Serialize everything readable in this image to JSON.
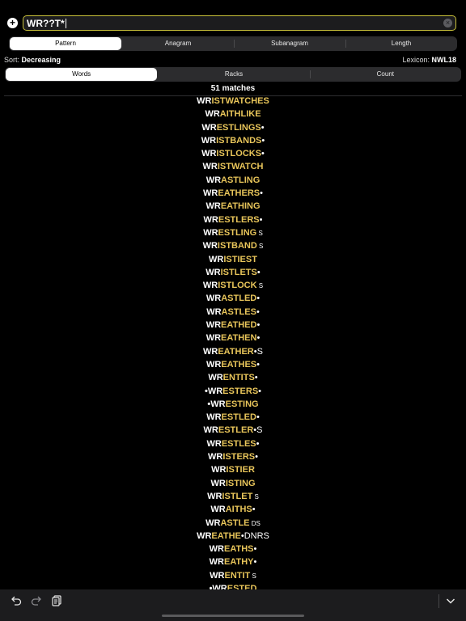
{
  "search": {
    "value": "WR??T*",
    "clear_label": "×"
  },
  "add_label": "+",
  "mode_tabs": [
    {
      "label": "Pattern",
      "active": true
    },
    {
      "label": "Anagram",
      "active": false
    },
    {
      "label": "Subanagram",
      "active": false
    },
    {
      "label": "Length",
      "active": false
    }
  ],
  "sort": {
    "label": "Sort:",
    "value": "Decreasing"
  },
  "lexicon": {
    "label": "Lexicon:",
    "value": "NWL18"
  },
  "view_tabs": [
    {
      "label": "Words",
      "active": true
    },
    {
      "label": "Racks",
      "active": false
    },
    {
      "label": "Count",
      "active": false
    }
  ],
  "match_count": "51 matches",
  "colors": {
    "fixed": "#ffffff",
    "wild": "#e8c55a",
    "search_border": "#c9c13a",
    "toolbar": "#1c1c1e"
  },
  "words": [
    {
      "front": "",
      "parts": [
        [
          "WR",
          "f"
        ],
        [
          "IST",
          "w"
        ],
        [
          "WATCHES",
          "w"
        ]
      ],
      "back": ""
    },
    {
      "front": "",
      "parts": [
        [
          "WR",
          "f"
        ],
        [
          "AIT",
          "w"
        ],
        [
          "HLIKE",
          "w"
        ]
      ],
      "back": ""
    },
    {
      "front": "",
      "parts": [
        [
          "WR",
          "f"
        ],
        [
          "EST",
          "w"
        ],
        [
          "LINGS",
          "w"
        ]
      ],
      "back": "•"
    },
    {
      "front": "",
      "parts": [
        [
          "WR",
          "f"
        ],
        [
          "IST",
          "w"
        ],
        [
          "BANDS",
          "w"
        ]
      ],
      "back": "•"
    },
    {
      "front": "",
      "parts": [
        [
          "WR",
          "f"
        ],
        [
          "IST",
          "w"
        ],
        [
          "LOCKS",
          "w"
        ]
      ],
      "back": "•"
    },
    {
      "front": "",
      "parts": [
        [
          "WR",
          "f"
        ],
        [
          "IST",
          "w"
        ],
        [
          "WATCH",
          "w"
        ]
      ],
      "back": ""
    },
    {
      "front": "",
      "parts": [
        [
          "WR",
          "f"
        ],
        [
          "AST",
          "w"
        ],
        [
          "LING",
          "w"
        ]
      ],
      "back": ""
    },
    {
      "front": "",
      "parts": [
        [
          "WR",
          "f"
        ],
        [
          "EAT",
          "w"
        ],
        [
          "HERS",
          "w"
        ]
      ],
      "back": "•"
    },
    {
      "front": "",
      "parts": [
        [
          "WR",
          "f"
        ],
        [
          "EAT",
          "w"
        ],
        [
          "HING",
          "w"
        ]
      ],
      "back": ""
    },
    {
      "front": "",
      "parts": [
        [
          "WR",
          "f"
        ],
        [
          "EST",
          "w"
        ],
        [
          "LERS",
          "w"
        ]
      ],
      "back": "•"
    },
    {
      "front": "",
      "parts": [
        [
          "WR",
          "f"
        ],
        [
          "EST",
          "w"
        ],
        [
          "LING",
          "w"
        ]
      ],
      "back": " S"
    },
    {
      "front": "",
      "parts": [
        [
          "WR",
          "f"
        ],
        [
          "IST",
          "w"
        ],
        [
          "BAND",
          "w"
        ]
      ],
      "back": " S"
    },
    {
      "front": "",
      "parts": [
        [
          "WR",
          "f"
        ],
        [
          "IST",
          "w"
        ],
        [
          "IEST",
          "w"
        ]
      ],
      "back": ""
    },
    {
      "front": "",
      "parts": [
        [
          "WR",
          "f"
        ],
        [
          "IST",
          "w"
        ],
        [
          "LETS",
          "w"
        ]
      ],
      "back": "•"
    },
    {
      "front": "",
      "parts": [
        [
          "WR",
          "f"
        ],
        [
          "IST",
          "w"
        ],
        [
          "LOCK",
          "w"
        ]
      ],
      "back": " S"
    },
    {
      "front": "",
      "parts": [
        [
          "WR",
          "f"
        ],
        [
          "AST",
          "w"
        ],
        [
          "LED",
          "w"
        ]
      ],
      "back": "•"
    },
    {
      "front": "",
      "parts": [
        [
          "WR",
          "f"
        ],
        [
          "AST",
          "w"
        ],
        [
          "LES",
          "w"
        ]
      ],
      "back": "•"
    },
    {
      "front": "",
      "parts": [
        [
          "WR",
          "f"
        ],
        [
          "EAT",
          "w"
        ],
        [
          "HED",
          "w"
        ]
      ],
      "back": "•"
    },
    {
      "front": "",
      "parts": [
        [
          "WR",
          "f"
        ],
        [
          "EAT",
          "w"
        ],
        [
          "HEN",
          "w"
        ]
      ],
      "back": "•"
    },
    {
      "front": "",
      "parts": [
        [
          "WR",
          "f"
        ],
        [
          "EAT",
          "w"
        ],
        [
          "HER",
          "w"
        ]
      ],
      "back": "•S"
    },
    {
      "front": "",
      "parts": [
        [
          "WR",
          "f"
        ],
        [
          "EAT",
          "w"
        ],
        [
          "HES",
          "w"
        ]
      ],
      "back": "•"
    },
    {
      "front": "",
      "parts": [
        [
          "WR",
          "f"
        ],
        [
          "ENT",
          "w"
        ],
        [
          "ITS",
          "w"
        ]
      ],
      "back": "•"
    },
    {
      "front": "•",
      "parts": [
        [
          "WR",
          "f"
        ],
        [
          "EST",
          "w"
        ],
        [
          "ERS",
          "w"
        ]
      ],
      "back": "•"
    },
    {
      "front": "•",
      "parts": [
        [
          "WR",
          "f"
        ],
        [
          "EST",
          "w"
        ],
        [
          "ING",
          "w"
        ]
      ],
      "back": ""
    },
    {
      "front": "",
      "parts": [
        [
          "WR",
          "f"
        ],
        [
          "EST",
          "w"
        ],
        [
          "LED",
          "w"
        ]
      ],
      "back": "•"
    },
    {
      "front": "",
      "parts": [
        [
          "WR",
          "f"
        ],
        [
          "EST",
          "w"
        ],
        [
          "LER",
          "w"
        ]
      ],
      "back": "•S"
    },
    {
      "front": "",
      "parts": [
        [
          "WR",
          "f"
        ],
        [
          "EST",
          "w"
        ],
        [
          "LES",
          "w"
        ]
      ],
      "back": "•"
    },
    {
      "front": "",
      "parts": [
        [
          "WR",
          "f"
        ],
        [
          "IST",
          "w"
        ],
        [
          "ERS",
          "w"
        ]
      ],
      "back": "•"
    },
    {
      "front": "",
      "parts": [
        [
          "WR",
          "f"
        ],
        [
          "IST",
          "w"
        ],
        [
          "IER",
          "w"
        ]
      ],
      "back": ""
    },
    {
      "front": "",
      "parts": [
        [
          "WR",
          "f"
        ],
        [
          "IST",
          "w"
        ],
        [
          "ING",
          "w"
        ]
      ],
      "back": ""
    },
    {
      "front": "",
      "parts": [
        [
          "WR",
          "f"
        ],
        [
          "IST",
          "w"
        ],
        [
          "LET",
          "w"
        ]
      ],
      "back": " S"
    },
    {
      "front": "",
      "parts": [
        [
          "WR",
          "f"
        ],
        [
          "AIT",
          "w"
        ],
        [
          "HS",
          "w"
        ]
      ],
      "back": "•"
    },
    {
      "front": "",
      "parts": [
        [
          "WR",
          "f"
        ],
        [
          "AST",
          "w"
        ],
        [
          "LE",
          "w"
        ]
      ],
      "back": " DS"
    },
    {
      "front": "",
      "parts": [
        [
          "WR",
          "f"
        ],
        [
          "EAT",
          "w"
        ],
        [
          "HE",
          "w"
        ]
      ],
      "back": "•DNRS"
    },
    {
      "front": "",
      "parts": [
        [
          "WR",
          "f"
        ],
        [
          "EAT",
          "w"
        ],
        [
          "HS",
          "w"
        ]
      ],
      "back": "•"
    },
    {
      "front": "",
      "parts": [
        [
          "WR",
          "f"
        ],
        [
          "EAT",
          "w"
        ],
        [
          "HY",
          "w"
        ]
      ],
      "back": "•"
    },
    {
      "front": "",
      "parts": [
        [
          "WR",
          "f"
        ],
        [
          "ENT",
          "w"
        ],
        [
          "IT",
          "w"
        ]
      ],
      "back": " S"
    },
    {
      "front": "•",
      "parts": [
        [
          "WR",
          "f"
        ],
        [
          "EST",
          "w"
        ],
        [
          "ED",
          "w"
        ]
      ],
      "back": ""
    }
  ]
}
